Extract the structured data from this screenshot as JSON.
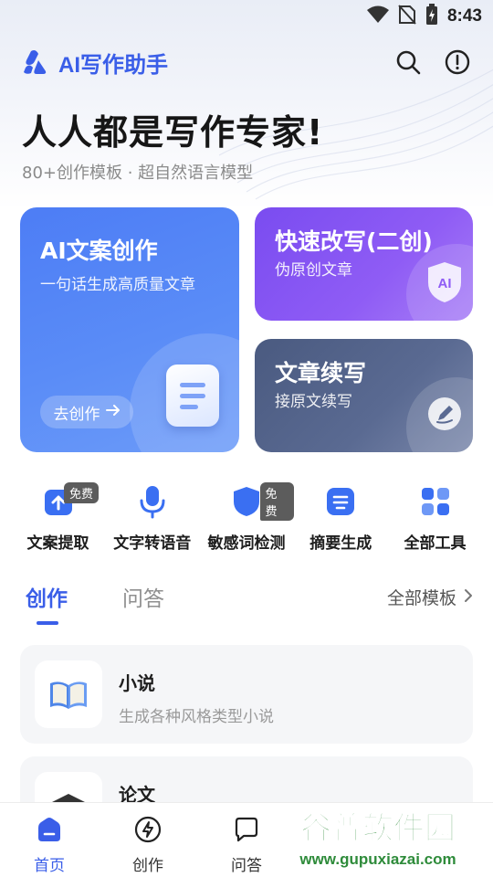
{
  "status_bar": {
    "time": "8:43"
  },
  "header": {
    "app_title": "AI写作助手"
  },
  "hero": {
    "title": "人人都是写作专家!",
    "subtitle": "80+创作模板 · 超自然语言模型"
  },
  "cards": {
    "ai_copy": {
      "title": "AI文案创作",
      "subtitle": "一句话生成高质量文章",
      "button": "去创作"
    },
    "rewrite": {
      "title": "快速改写(二创)",
      "subtitle": "伪原创文章",
      "badge": "AI"
    },
    "continue": {
      "title": "文章续写",
      "subtitle": "接原文续写"
    }
  },
  "tools": [
    {
      "label": "文案提取",
      "icon": "upload-icon",
      "badge": "免费"
    },
    {
      "label": "文字转语音",
      "icon": "microphone-icon",
      "badge": ""
    },
    {
      "label": "敏感词检测",
      "icon": "shield-icon",
      "badge": "免费"
    },
    {
      "label": "摘要生成",
      "icon": "list-icon",
      "badge": ""
    },
    {
      "label": "全部工具",
      "icon": "grid-icon",
      "badge": ""
    }
  ],
  "tabs": {
    "active": "创作",
    "inactive": "问答",
    "all_templates": "全部模板"
  },
  "list": [
    {
      "title": "小说",
      "subtitle": "生成各种风格类型小说",
      "icon": "book-icon"
    },
    {
      "title": "论文",
      "subtitle": "",
      "icon": "graduation-cap-icon"
    }
  ],
  "bottom_nav": [
    {
      "label": "首页",
      "icon": "home-icon",
      "active": true
    },
    {
      "label": "创作",
      "icon": "lightning-icon",
      "active": false
    },
    {
      "label": "问答",
      "icon": "chat-icon",
      "active": false
    }
  ],
  "watermark": {
    "line1": "谷普软件园",
    "line2": "www.gupuxiazai.com"
  },
  "colors": {
    "accent": "#3a5ee8",
    "card_blue": "#5a8cf7",
    "card_purple": "#8f5cf5",
    "card_slate": "#5a6a92"
  }
}
